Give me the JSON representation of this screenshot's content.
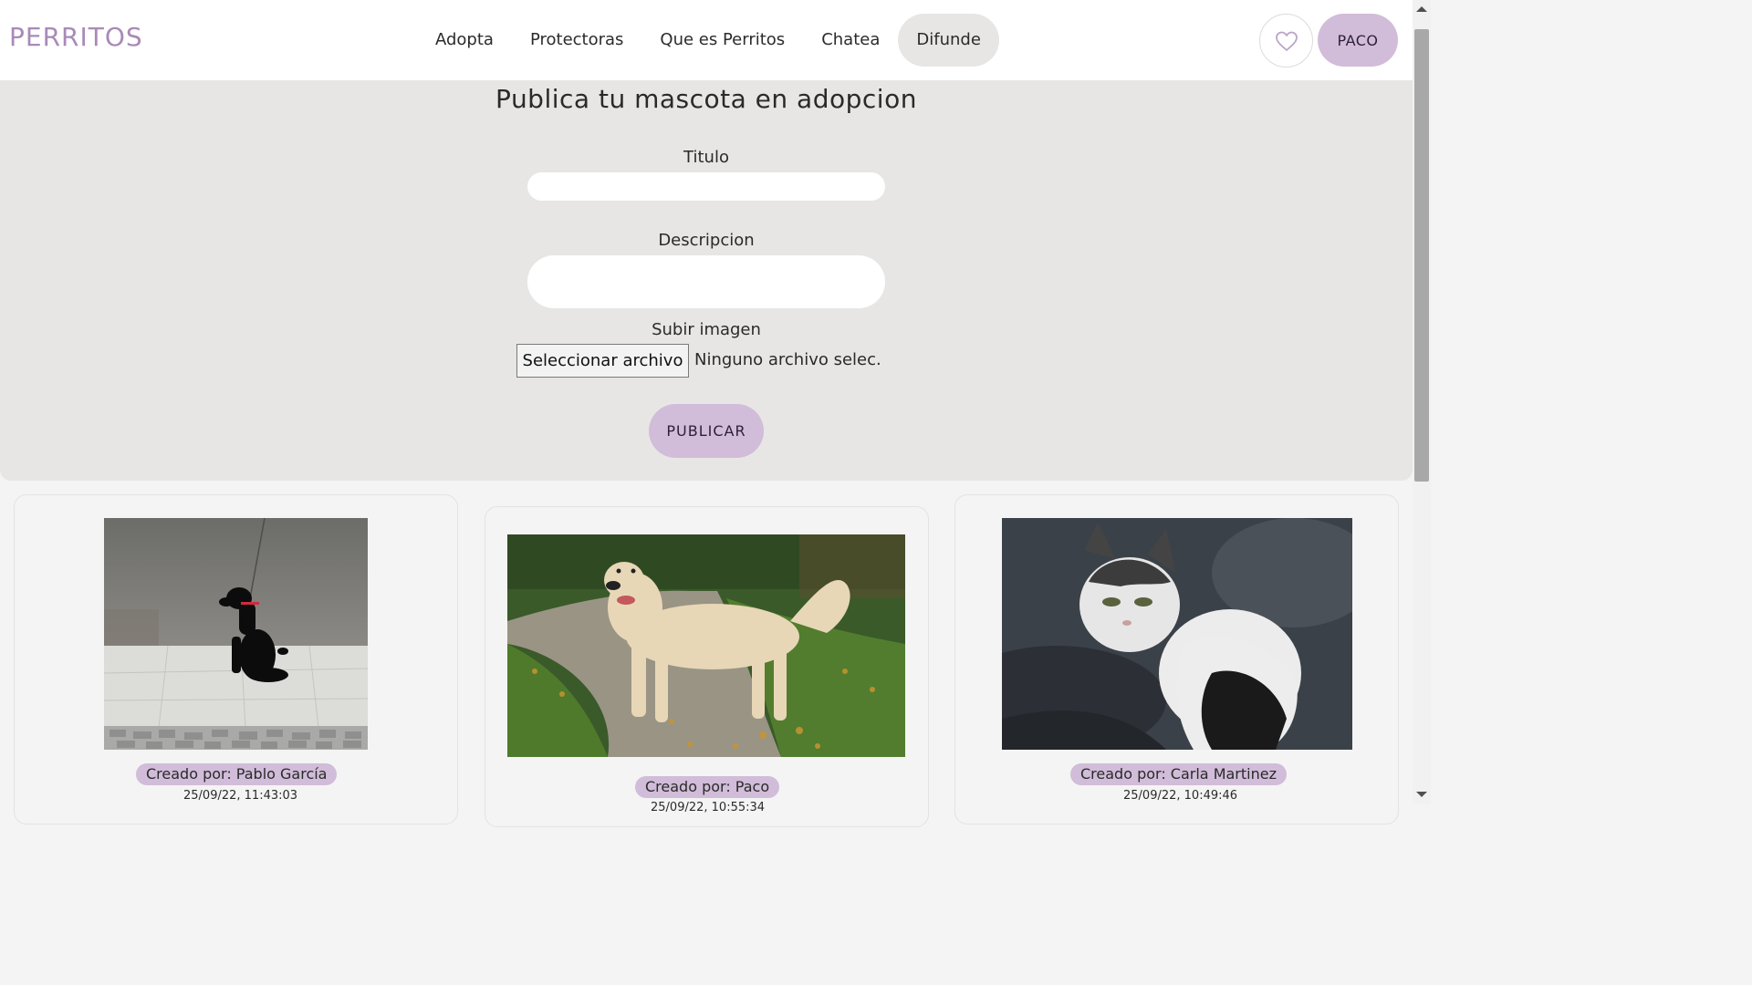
{
  "brand": "PERRITOS",
  "nav": [
    "Adopta",
    "Protectoras",
    "Que es Perritos",
    "Chatea",
    "Difunde"
  ],
  "active_nav": "Difunde",
  "user_label": "PACO",
  "icons": {
    "favorites": "heart-icon"
  },
  "colors": {
    "accent": "#d1bcd9",
    "brand": "#a98ab8",
    "panel": "#e7e6e4"
  },
  "form": {
    "title": "Publica tu mascota en adopcion",
    "title_label": "Titulo",
    "title_value": "",
    "description_label": "Descripcion",
    "description_value": "",
    "image_label": "Subir imagen",
    "file_button": "Seleccionar archivo",
    "file_status": "Ninguno archivo selec.",
    "submit": "PUBLICAR"
  },
  "posts": [
    {
      "author": "Creado por: Pablo García",
      "timestamp": "25/09/22, 11:43:03"
    },
    {
      "author": "Creado por: Paco",
      "timestamp": "25/09/22, 10:55:34"
    },
    {
      "author": "Creado por: Carla Martinez",
      "timestamp": "25/09/22, 10:49:46"
    }
  ]
}
